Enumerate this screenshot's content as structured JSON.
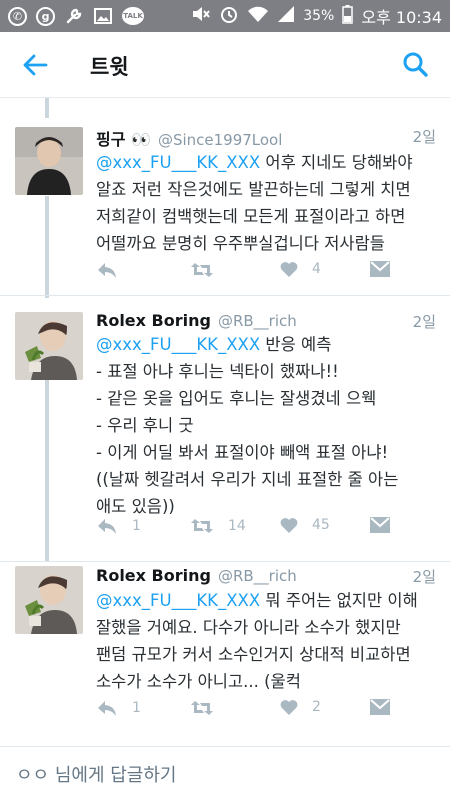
{
  "status_bar": {
    "battery": "35%",
    "time": "오후 10:34",
    "icons": [
      "phone-icon",
      "g-icon",
      "wrench-icon",
      "gallery-icon",
      "talk-icon",
      "mute-icon",
      "alarm-icon",
      "wifi-icon",
      "signal-icon",
      "battery-icon"
    ],
    "talk_label": "TALK"
  },
  "app_bar": {
    "title": "트윗"
  },
  "colors": {
    "accent": "#1da1f2",
    "mention": "#1da1f2",
    "muted": "#8899a6",
    "icon": "#aab8c2",
    "statusbar": "#7d7f84"
  },
  "tweets": [
    {
      "name": "핑구 👀",
      "handle": "@Since1997Lool",
      "time": "2일",
      "mention": "@xxx_FU___KK_XXX",
      "line1_rest": " 어후 지네도 당해봐야",
      "lines": [
        "알죠 저런 작은것에도 발끈하는데 그렇게 치면",
        "저희같이 컴백햇는데 모든게 표절이라고 하면",
        "어떨까요 분명히 우주뿌실겁니다 저사람들"
      ],
      "retweets": "",
      "likes": "4"
    },
    {
      "name": "Rolex Boring",
      "handle": "@RB__rich",
      "time": "2일",
      "mention": "@xxx_FU___KK_XXX",
      "line1_rest": " 반응 예측",
      "lines": [
        "- 표절 아냐 후니는 넥타이 했짜나!!",
        "- 같은 옷을 입어도 후니는 잘생겼네 으웩",
        "- 우리 후니 굿",
        "- 이게 어딜 봐서 표절이야 빼액 표절 아냐!",
        "((날짜 헷갈려서 우리가 지네 표절한 줄 아는",
        "애도 있음))"
      ],
      "replies": "1",
      "retweets": "14",
      "likes": "45"
    },
    {
      "name": "Rolex Boring",
      "handle": "@RB__rich",
      "time": "2일",
      "mention": "@xxx_FU___KK_XXX",
      "line1_rest": " 뭐 주어는 없지만 이해",
      "lines": [
        "잘했을 거예요. 다수가 아니라 소수가 했지만",
        "팬덤 규모가 커서 소수인거지 상대적 비교하면",
        "소수가 소수가 아니고... (울컥"
      ],
      "replies": "1",
      "retweets": "",
      "likes": "2"
    }
  ],
  "reply_bar": {
    "placeholder": "ㅇㅇ 님에게 답글하기"
  }
}
